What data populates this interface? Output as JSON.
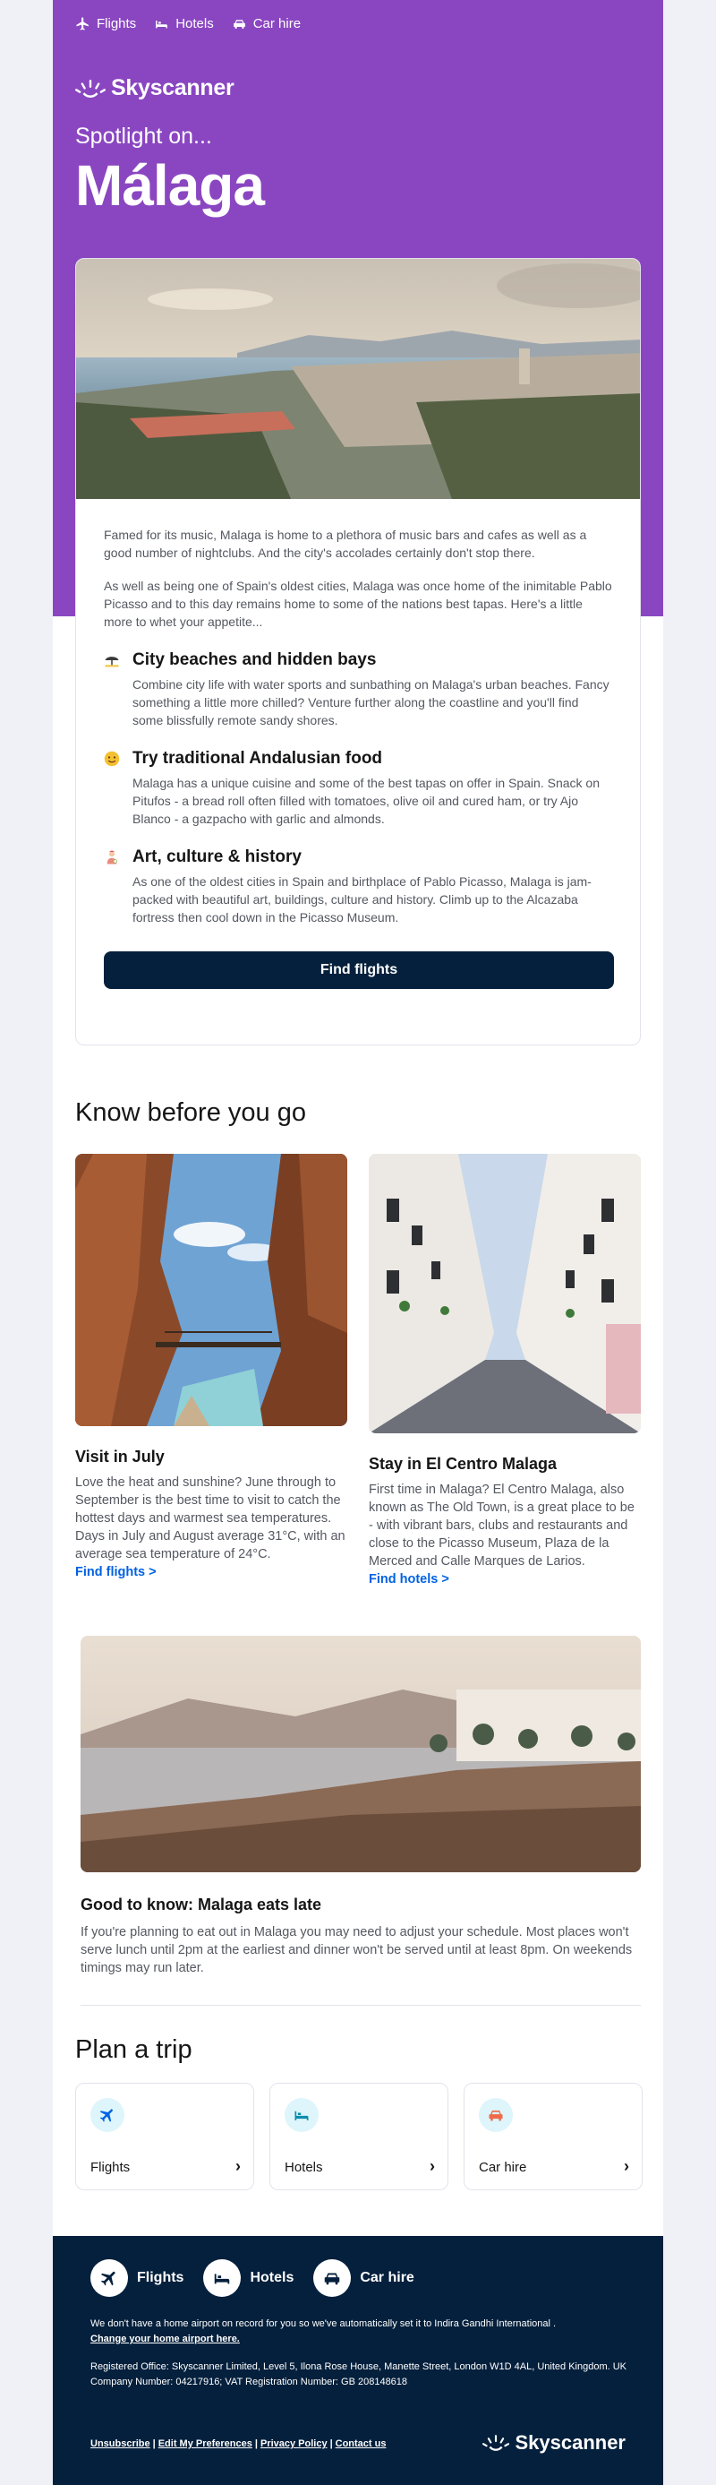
{
  "colors": {
    "brand_purple": "#8a46c1",
    "navy": "#05203c",
    "link_blue": "#0062e3",
    "tile_circle": "#ddf5fb"
  },
  "top_nav": [
    {
      "label": "Flights",
      "icon": "plane-icon"
    },
    {
      "label": "Hotels",
      "icon": "bed-icon"
    },
    {
      "label": "Car hire",
      "icon": "car-icon"
    }
  ],
  "brand": {
    "name": "Skyscanner",
    "icon": "sunrise-logo-icon"
  },
  "hero": {
    "eyebrow": "Spotlight on...",
    "city": "Málaga"
  },
  "card": {
    "intro": [
      "Famed for its music, Malaga is home to a plethora of music bars and cafes as well as a good number of nightclubs. And the city's accolades certainly don't stop there.",
      "As well as being one of Spain's oldest cities, Malaga was once home of the inimitable Pablo Picasso and to this day remains home to some of the nations best tapas. Here's a little more to whet your appetite..."
    ],
    "features": [
      {
        "icon": "beach-umbrella-icon",
        "title": "City beaches and hidden bays",
        "text": "Combine city life with water sports and sunbathing on Malaga's urban beaches. Fancy something a little more chilled? Venture further along the coastline and you'll find some blissfully remote sandy shores."
      },
      {
        "icon": "yum-face-icon",
        "title": "Try traditional Andalusian food",
        "text": "Malaga has a unique cuisine and some of the best tapas on offer in Spain. Snack on Pitufos - a bread roll often filled with tomatoes, olive oil and cured ham, or try Ajo Blanco - a gazpacho with garlic and almonds."
      },
      {
        "icon": "artist-icon",
        "title": "Art, culture & history",
        "text": "As one of the oldest cities in Spain and birthplace of Pablo Picasso, Malaga is jam-packed with beautiful art, buildings, culture and history. Climb up to the Alcazaba fortress then cool down in the Picasso Museum."
      }
    ],
    "cta": "Find flights"
  },
  "know_before": {
    "heading": "Know before you go",
    "left": {
      "title": "Visit in July",
      "text": "Love the heat and sunshine? June through to September is the best time to visit to catch the hottest days and warmest sea temperatures. Days in July and August average 31°C, with an average sea temperature of 24°C.",
      "link": "Find flights >"
    },
    "right": {
      "title": "Stay in El Centro Malaga",
      "text": "First time in Malaga? El Centro Malaga, also known as The Old Town, is a great place to be - with vibrant bars, clubs and restaurants and close to the Picasso Museum, Plaza de la Merced and Calle Marques de Larios.",
      "link": "Find hotels >"
    },
    "eat": {
      "title": "Good to know: Malaga eats late",
      "text": "If you're planning to eat out in Malaga you may need to adjust your schedule. Most places won't serve lunch until 2pm at the earliest and dinner won't be served until at least 8pm. On weekends timings may run later."
    }
  },
  "plan": {
    "heading": "Plan a trip",
    "tiles": [
      {
        "label": "Flights",
        "icon": "plane-icon",
        "chevron": "›"
      },
      {
        "label": "Hotels",
        "icon": "bed-icon",
        "chevron": "›"
      },
      {
        "label": "Car hire",
        "icon": "car-icon",
        "chevron": "›"
      }
    ]
  },
  "footer": {
    "nav": [
      {
        "label": "Flights",
        "icon": "plane-icon"
      },
      {
        "label": "Hotels",
        "icon": "bed-icon"
      },
      {
        "label": "Car hire",
        "icon": "car-icon"
      }
    ],
    "airport_note": "We don't have a home airport on record for you so we've automatically set it to Indira Gandhi International .",
    "airport_link": "Change your home airport here.",
    "registered": "Registered Office: Skyscanner Limited, Level 5, Ilona Rose House, Manette Street, London W1D 4AL, United Kingdom. UK Company Number: 04217916; VAT Registration Number: GB 208148618",
    "links": [
      "Unsubscribe",
      "Edit My Preferences",
      "Privacy Policy",
      "Contact us"
    ],
    "link_separator": "|"
  }
}
